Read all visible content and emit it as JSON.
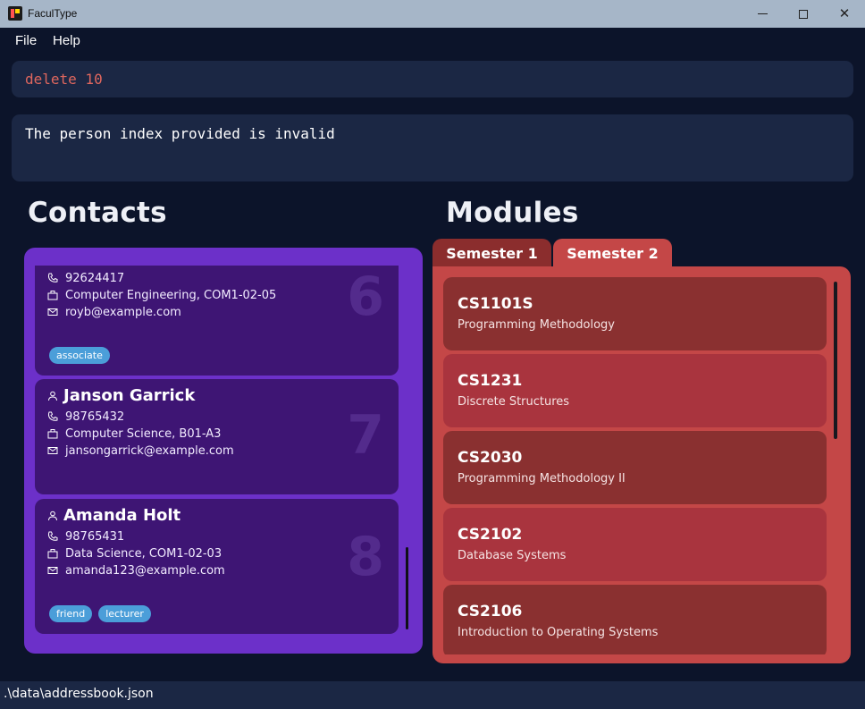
{
  "window": {
    "title": "FaculType"
  },
  "menu": {
    "file": "File",
    "help": "Help"
  },
  "command": {
    "value": "delete 10"
  },
  "result": {
    "text": "The person index provided is invalid"
  },
  "headings": {
    "contacts": "Contacts",
    "modules": "Modules"
  },
  "contacts": [
    {
      "index": "6",
      "phone": "92624417",
      "department": "Computer Engineering, COM1-02-05",
      "email": "royb@example.com",
      "tags": [
        "associate"
      ]
    },
    {
      "index": "7",
      "name": "Janson Garrick",
      "phone": "98765432",
      "department": "Computer Science, B01-A3",
      "email": "jansongarrick@example.com",
      "tags": []
    },
    {
      "index": "8",
      "name": "Amanda Holt",
      "phone": "98765431",
      "department": "Data Science, COM1-02-03",
      "email": "amanda123@example.com",
      "tags": [
        "friend",
        "lecturer"
      ]
    }
  ],
  "semesters": {
    "tab1": "Semester 1",
    "tab2": "Semester 2",
    "selected": "Semester 2"
  },
  "modules": [
    {
      "code": "CS1101S",
      "name": "Programming Methodology"
    },
    {
      "code": "CS1231",
      "name": "Discrete Structures"
    },
    {
      "code": "CS2030",
      "name": "Programming Methodology II"
    },
    {
      "code": "CS2102",
      "name": "Database Systems"
    },
    {
      "code": "CS2106",
      "name": "Introduction to Operating Systems"
    }
  ],
  "status": {
    "path": ".\\data\\addressbook.json"
  },
  "colors": {
    "accent_purple": "#6c30c9",
    "accent_red": "#c44747",
    "tag_blue": "#4b9ed9",
    "error_text": "#e0675e"
  }
}
